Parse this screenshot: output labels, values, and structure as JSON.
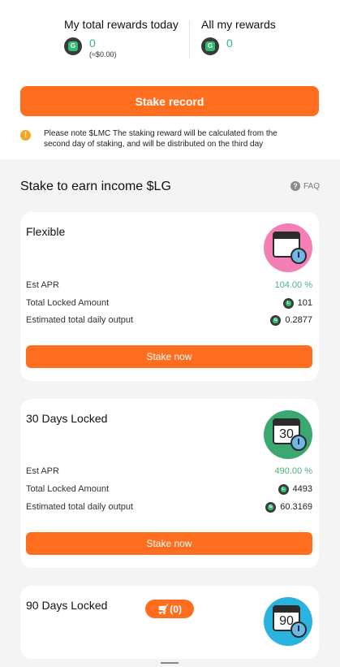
{
  "rewards": {
    "today_label": "My total rewards today",
    "today_value": "0",
    "today_usd": "(≈$0.00)",
    "all_label": "All my rewards",
    "all_value": "0"
  },
  "stake_record_label": "Stake record",
  "note": "Please note $LMC The staking reward will be calculated from the second day of staking, and will be distributed on the third day",
  "section": {
    "title": "Stake to earn income $LG",
    "faq_label": "FAQ"
  },
  "labels": {
    "apr": "Est APR",
    "locked": "Total Locked Amount",
    "output": "Estimated total daily output",
    "stake_now": "Stake now"
  },
  "cards": [
    {
      "title": "Flexible",
      "apr": "104.00 %",
      "locked": "101",
      "output": "0.2877",
      "icon_color": "#f47fb4",
      "calendar_text": ""
    },
    {
      "title": "30 Days Locked",
      "apr": "490.00 %",
      "locked": "4493",
      "output": "60.3169",
      "icon_color": "#3aa870",
      "calendar_text": "30"
    },
    {
      "title": "90 Days Locked",
      "calendar_text": "90",
      "icon_color": "#2bb3e0",
      "cart_label": "(0)"
    }
  ],
  "colors": {
    "accent": "#ff6d1f",
    "green_text": "#37b37a",
    "warn": "#f5a623"
  },
  "icons": [
    "lg-coin-icon",
    "lmc-coin-icon",
    "warning-icon",
    "help-icon",
    "calendar-clock-icon",
    "cart-icon"
  ]
}
